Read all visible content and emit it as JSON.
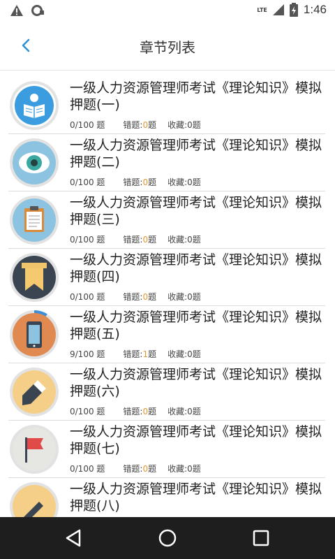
{
  "status": {
    "time": "1:46",
    "network": "LTE"
  },
  "header": {
    "title": "章节列表"
  },
  "items": [
    {
      "title": "一级人力资源管理师考试《理论知识》模拟押题(一)",
      "progress": "0/100 题",
      "wrong_label": "错题:",
      "wrong": "0",
      "wrong_unit": "题",
      "fav_label": "收藏:",
      "fav": "0",
      "fav_unit": "题",
      "icon": "reading-book-icon"
    },
    {
      "title": "一级人力资源管理师考试《理论知识》模拟押题(二)",
      "progress": "0/100 题",
      "wrong_label": "错题:",
      "wrong": "0",
      "wrong_unit": "题",
      "fav_label": "收藏:",
      "fav": "0",
      "fav_unit": "题",
      "icon": "eye-icon"
    },
    {
      "title": "一级人力资源管理师考试《理论知识》模拟押题(三)",
      "progress": "0/100 题",
      "wrong_label": "错题:",
      "wrong": "0",
      "wrong_unit": "题",
      "fav_label": "收藏:",
      "fav": "0",
      "fav_unit": "题",
      "icon": "clipboard-icon"
    },
    {
      "title": "一级人力资源管理师考试《理论知识》模拟押题(四)",
      "progress": "0/100 题",
      "wrong_label": "错题:",
      "wrong": "0",
      "wrong_unit": "题",
      "fav_label": "收藏:",
      "fav": "0",
      "fav_unit": "题",
      "icon": "bookmark-icon"
    },
    {
      "title": "一级人力资源管理师考试《理论知识》模拟押题(五)",
      "progress": "9/100 题",
      "wrong_label": "错题:",
      "wrong": "1",
      "wrong_unit": "题",
      "fav_label": "收藏:",
      "fav": "0",
      "fav_unit": "题",
      "icon": "tablet-icon"
    },
    {
      "title": "一级人力资源管理师考试《理论知识》模拟押题(六)",
      "progress": "0/100 题",
      "wrong_label": "错题:",
      "wrong": "0",
      "wrong_unit": "题",
      "fav_label": "收藏:",
      "fav": "0",
      "fav_unit": "题",
      "icon": "pencil-icon"
    },
    {
      "title": "一级人力资源管理师考试《理论知识》模拟押题(七)",
      "progress": "0/100 题",
      "wrong_label": "错题:",
      "wrong": "0",
      "wrong_unit": "题",
      "fav_label": "收藏:",
      "fav": "0",
      "fav_unit": "题",
      "icon": "flag-icon"
    },
    {
      "title": "一级人力资源管理师考试《理论知识》模拟押题(八)",
      "progress": "",
      "wrong_label": "",
      "wrong": "",
      "wrong_unit": "",
      "fav_label": "",
      "fav": "",
      "fav_unit": "",
      "icon": "pen-icon"
    }
  ],
  "colors": {
    "accent": "#2f8fd6",
    "highlight": "#e39a2e",
    "navbar": "#1e1e1e"
  }
}
